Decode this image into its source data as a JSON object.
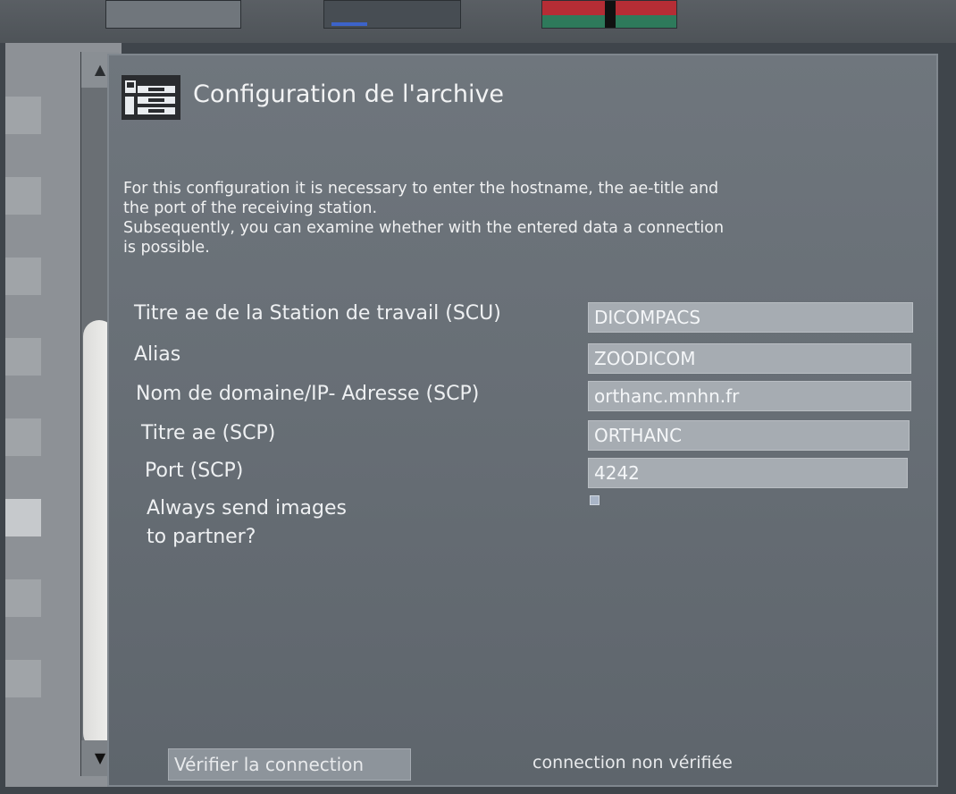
{
  "dialog": {
    "title": "Configuration de l'archive",
    "description": [
      "For this configuration it is necessary to enter the hostname, the ae-title and",
      "the port of the receiving station.",
      "Subsequently, you can examine whether with the entered data a connection",
      "is possible."
    ]
  },
  "form": {
    "fields": [
      {
        "label": "Titre ae de la Station de travail (SCU)",
        "value": "DICOMPACS"
      },
      {
        "label": "Alias",
        "value": "ZOODICOM"
      },
      {
        "label": "Nom de domaine/IP- Adresse (SCP)",
        "value": "orthanc.mnhn.fr"
      },
      {
        "label": "Titre ae (SCP)",
        "value": "ORTHANC"
      },
      {
        "label": "Port (SCP)",
        "value": "4242"
      }
    ],
    "always_send": {
      "label_line1": "Always send images",
      "label_line2": "to partner?",
      "checked": false
    }
  },
  "footer": {
    "verify_button": "Vérifier la connection",
    "status": "connection non vérifiée"
  },
  "icons": {
    "header": "archive-config-icon",
    "scroll_up": "scroll-up-arrow-icon",
    "scroll_down": "scroll-down-arrow-icon"
  },
  "colors": {
    "panel": "#6a7178",
    "input": "#a6acb2",
    "text": "#eef0f2"
  }
}
